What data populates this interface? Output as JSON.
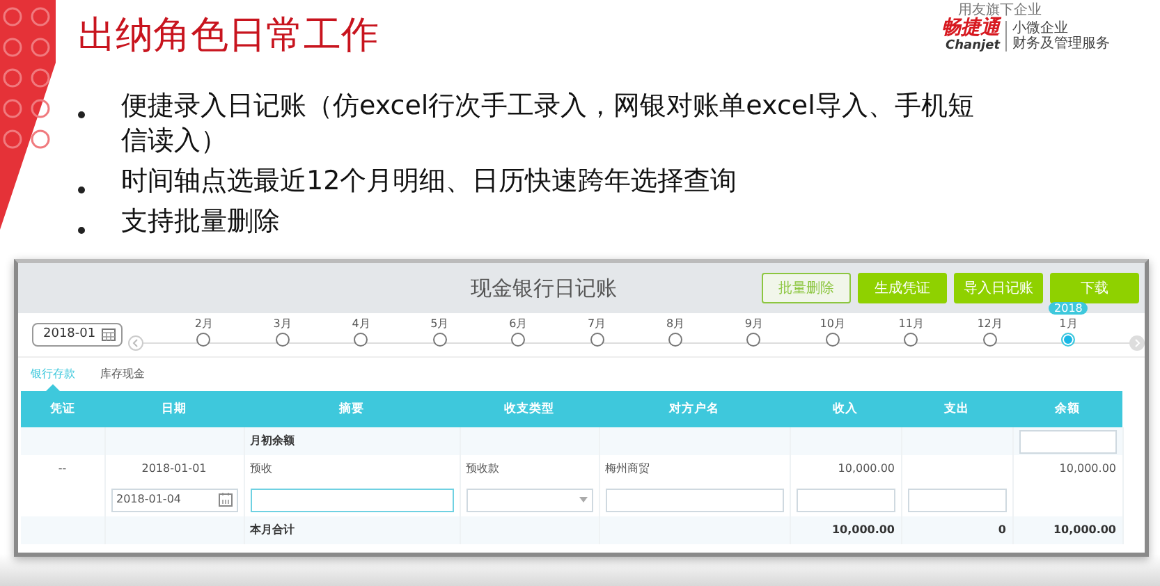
{
  "slide": {
    "title": "出纳角色日常工作",
    "logo": {
      "tagline": "用友旗下企业",
      "brand": "畅捷通",
      "latin": "Chanjet",
      "slogan": [
        "小微企业",
        "财务及管理服务"
      ]
    },
    "bullets": [
      "便捷录入日记账（仿excel行次手工录入，网银对账单excel导入、手机短信读入）",
      "时间轴点选最近12个月明细、日历快速跨年选择查询",
      "支持批量删除"
    ]
  },
  "app": {
    "title": "现金银行日记账",
    "buttons": [
      {
        "label": "批量删除",
        "kind": "outline"
      },
      {
        "label": "生成凭证",
        "kind": "solid"
      },
      {
        "label": "导入日记账",
        "kind": "solid"
      },
      {
        "label": "下载",
        "kind": "solid"
      }
    ],
    "period": "2018-01",
    "timeline": [
      {
        "month": "2月",
        "selected": false
      },
      {
        "month": "3月",
        "selected": false
      },
      {
        "month": "4月",
        "selected": false
      },
      {
        "month": "5月",
        "selected": false
      },
      {
        "month": "6月",
        "selected": false
      },
      {
        "month": "7月",
        "selected": false
      },
      {
        "month": "8月",
        "selected": false
      },
      {
        "month": "9月",
        "selected": false
      },
      {
        "month": "10月",
        "selected": false
      },
      {
        "month": "11月",
        "selected": false
      },
      {
        "month": "12月",
        "selected": false
      },
      {
        "month": "1月",
        "selected": true,
        "year": "2018"
      }
    ],
    "tabs": [
      {
        "label": "银行存款",
        "selected": true
      },
      {
        "label": "库存现金",
        "selected": false
      }
    ],
    "columns": [
      "凭证",
      "日期",
      "摘要",
      "收支类型",
      "对方户名",
      "收入",
      "支出",
      "余额"
    ],
    "rows": [
      {
        "kind": "opening",
        "label": "月初余额"
      },
      {
        "kind": "entry",
        "cells": [
          "--",
          "2018-01-01",
          "预收",
          "预收款",
          "梅州商贸",
          "10,000.00",
          null,
          "10,000.00"
        ]
      },
      {
        "kind": "edit",
        "date": "2018-01-04"
      },
      {
        "kind": "total",
        "label": "本月合计",
        "income": "10,000.00",
        "expense": "0",
        "balance": "10,000.00"
      }
    ]
  }
}
